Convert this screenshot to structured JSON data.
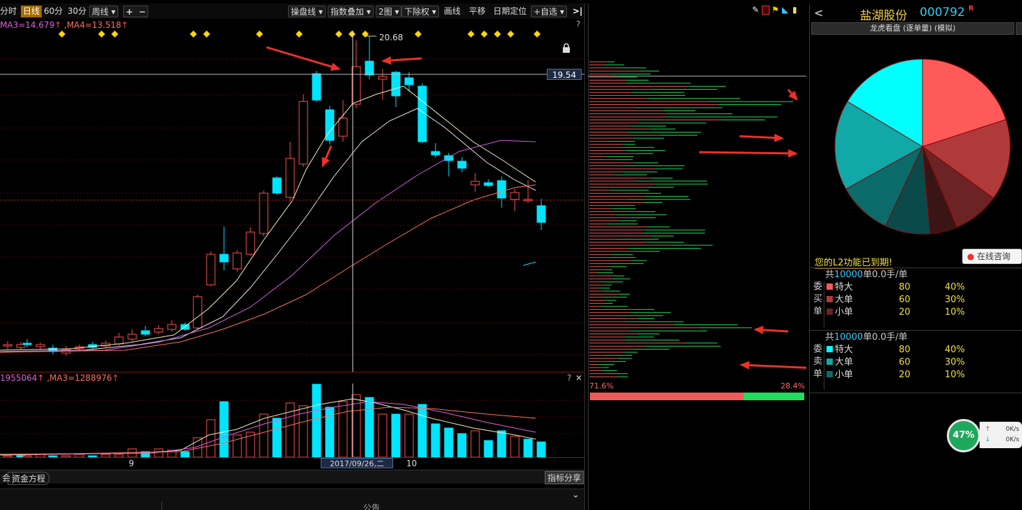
{
  "toolbar": {
    "period_tabs": [
      "分时",
      "日线",
      "60分",
      "30分",
      "周线"
    ],
    "selected_period": "日线",
    "zoom_in": "+",
    "zoom_out": "−",
    "menus": [
      "操盘线",
      "指数叠加",
      "2图",
      "下除权",
      "画线",
      "平移",
      "日期定位",
      "+自选"
    ],
    "expand": ">|"
  },
  "main_chart": {
    "ma_legend": "MA3=14.679",
    "ma_legend2": ",MA4=13.518",
    "high_label": "20.68",
    "cursor_price": "19.54",
    "help": "?",
    "lock_icon": "lock-icon"
  },
  "volume_chart": {
    "legend": "1955064",
    "legend2": ",MA3=1288976",
    "help": "?",
    "close": "✕"
  },
  "x_axis": {
    "month_label_1": "9",
    "cursor_date": "2017/09/26,二",
    "month_label_2": "10"
  },
  "bottom_tabs": [
    "会",
    "资金方程",
    "指标分享"
  ],
  "announcement": "公告",
  "mid_panel": {
    "left_pct": "71.6%",
    "right_pct": "28.4%",
    "progress_fraction": 0.716
  },
  "right_panel": {
    "back": "<",
    "stock_name": "盐湖股份",
    "stock_code": "000792",
    "badge": "R",
    "subtitle": "龙虎看盘 (逐单量) (模拟)",
    "expired_msg": "您的L2功能已到期!",
    "consult_button": "在线咨询",
    "buy": {
      "header_pre": "共",
      "header_num": "10000",
      "header_post": "单0.0手/单",
      "side_chars": [
        "委",
        "买",
        "单"
      ],
      "rows": [
        {
          "label": "特大",
          "count": "80",
          "pct": "40%",
          "color": "#ff5a5a"
        },
        {
          "label": "大单",
          "count": "60",
          "pct": "30%",
          "color": "#b03a3a"
        },
        {
          "label": "小单",
          "count": "20",
          "pct": "10%",
          "color": "#6b2323"
        }
      ]
    },
    "sell": {
      "header_pre": "共",
      "header_num": "10000",
      "header_post": "单0.0手/单",
      "side_chars": [
        "委",
        "卖",
        "单"
      ],
      "rows": [
        {
          "label": "特大",
          "count": "80",
          "pct": "40%",
          "color": "#00ffff"
        },
        {
          "label": "大单",
          "count": "60",
          "pct": "30%",
          "color": "#11a8a8"
        },
        {
          "label": "小单",
          "count": "20",
          "pct": "10%",
          "color": "#0b6b6b"
        }
      ]
    },
    "gauge_pct": "47%",
    "net_up": "0K/s",
    "net_down": "0K/s"
  }
}
